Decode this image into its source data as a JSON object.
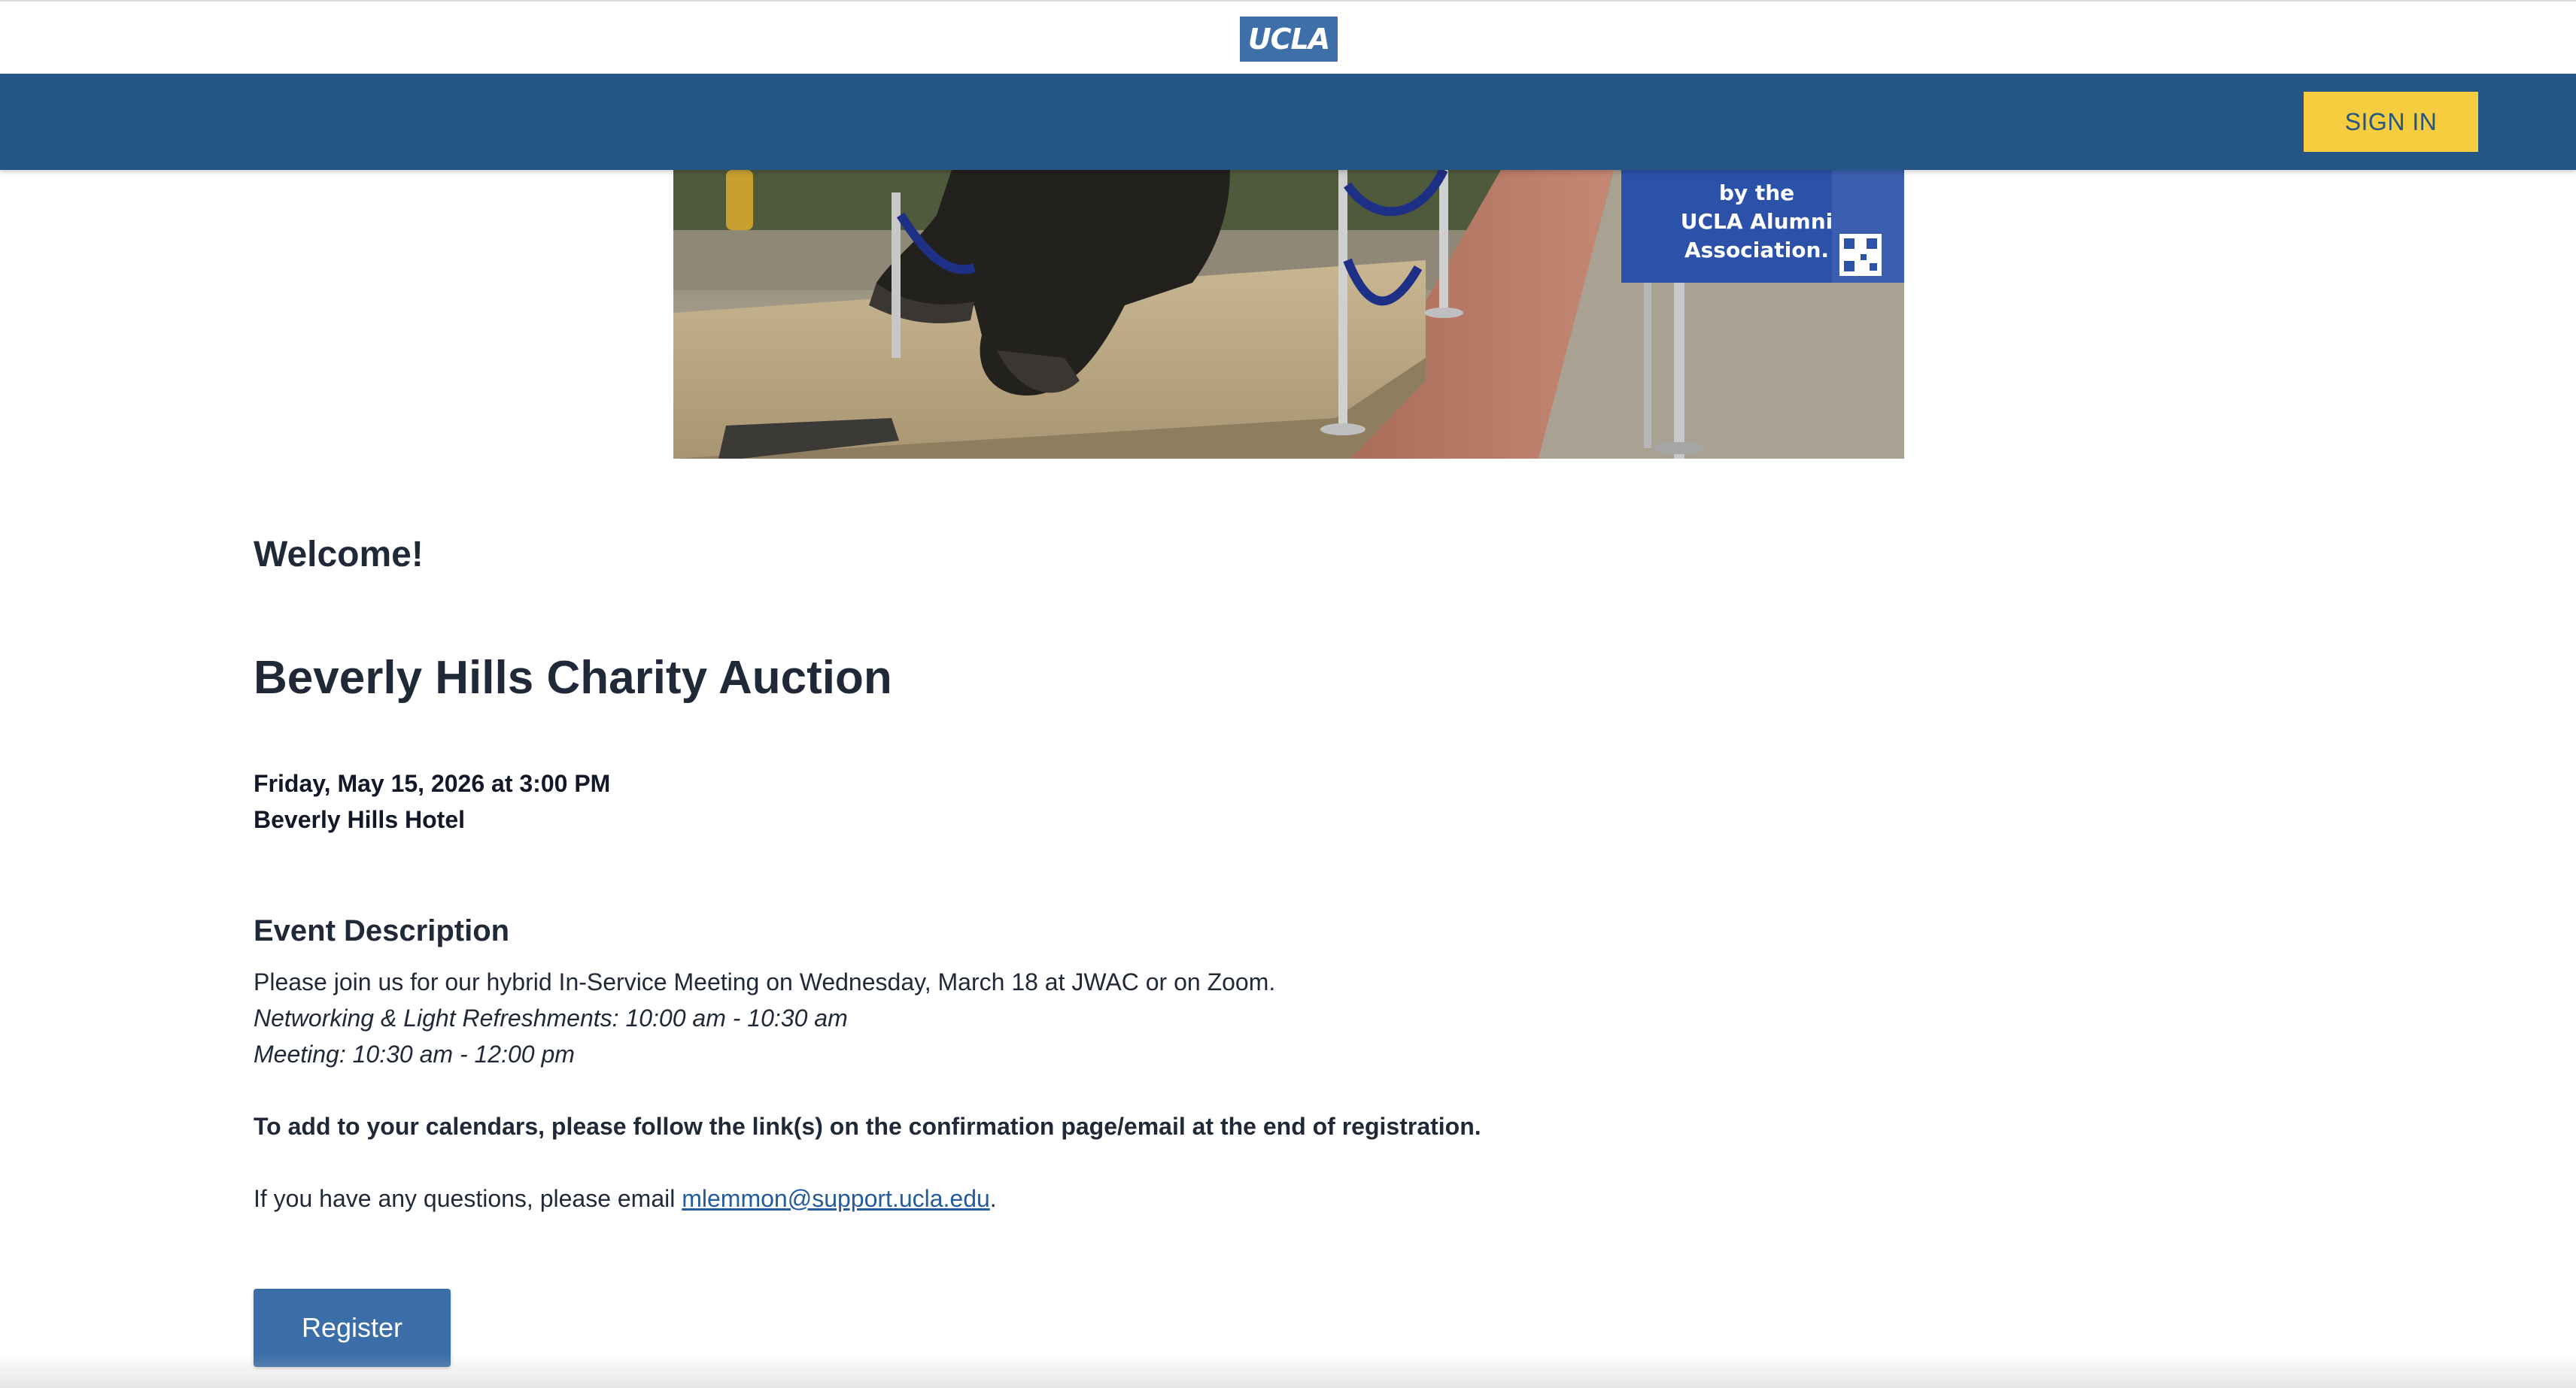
{
  "header": {
    "logo_text": "UCLA",
    "sign_in_label": "SIGN IN"
  },
  "hero": {
    "sign_lines": [
      "by the",
      "UCLA Alumni",
      "Association."
    ]
  },
  "main": {
    "welcome": "Welcome!",
    "event_title": "Beverly Hills Charity Auction",
    "event_date": "Friday, May 15, 2026 at 3:00 PM",
    "event_venue": "Beverly Hills Hotel",
    "description_heading": "Event Description",
    "description_line1": "Please join us for our hybrid In-Service Meeting on Wednesday, March 18 at JWAC or on Zoom.",
    "description_line2": "Networking & Light Refreshments: 10:00 am - 10:30 am",
    "description_line3": "Meeting: 10:30 am - 12:00 pm",
    "calendar_note": "To add to your calendars, please follow the link(s) on the confirmation page/email at the end of registration.",
    "questions_prefix": "If you have any questions, please email ",
    "contact_email": "mlemmon@support.ucla.edu",
    "questions_suffix": ".",
    "register_label": "Register"
  },
  "colors": {
    "nav_blue": "#245584",
    "logo_blue": "#3f6fa8",
    "sign_in_yellow": "#f6cd3f",
    "register_blue": "#3b6ea8",
    "link_blue": "#245c9c"
  }
}
